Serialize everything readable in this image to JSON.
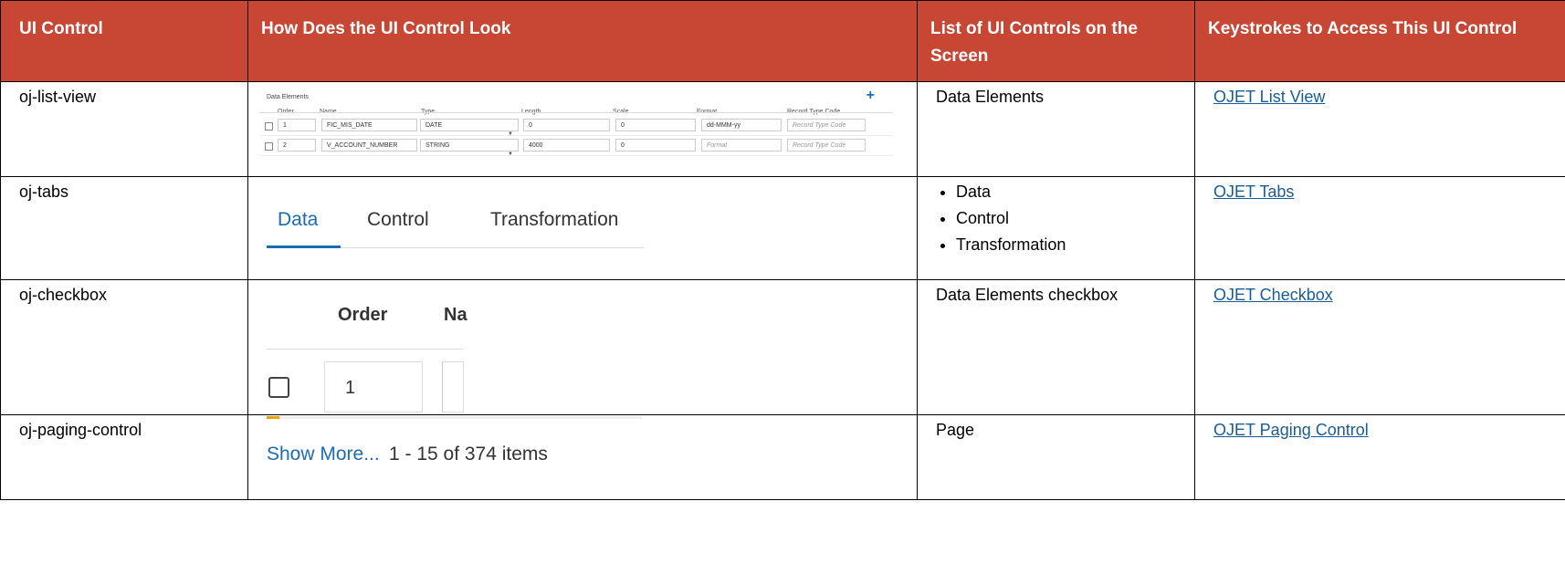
{
  "columns": [
    "UI Control",
    "How Does the UI Control Look",
    "List of UI Controls on the Screen",
    "Keystrokes to Access This UI Control"
  ],
  "rows": [
    {
      "control": "oj-list-view",
      "controls_on_screen": "Data Elements",
      "link": "OJET List View"
    },
    {
      "control": "oj-tabs",
      "controls_on_screen_list": [
        "Data",
        "Control",
        "Transformation"
      ],
      "link": "OJET Tabs"
    },
    {
      "control": "oj-checkbox",
      "controls_on_screen": "Data Elements checkbox",
      "link": "OJET Checkbox"
    },
    {
      "control": "oj-paging-control",
      "controls_on_screen": "Page",
      "link": "OJET Paging Control"
    }
  ],
  "list_view": {
    "title": "Data Elements",
    "add_icon": "plus-icon",
    "headers": [
      "Order",
      "Name",
      "Type",
      "Length",
      "Scale",
      "Format",
      "Record Type Code"
    ],
    "records": [
      {
        "order": "1",
        "name": "FIC_MIS_DATE",
        "type": "DATE",
        "length": "0",
        "scale": "0",
        "format": "dd-MMM-yy",
        "record_type_code": "Record Type Code"
      },
      {
        "order": "2",
        "name": "V_ACCOUNT_NUMBER",
        "type": "STRING",
        "length": "4000",
        "scale": "0",
        "format": "Format",
        "record_type_code": "Record Type Code"
      }
    ]
  },
  "tabs_sample": {
    "tabs": [
      "Data",
      "Control",
      "Transformation"
    ],
    "active": "Data"
  },
  "checkbox_sample": {
    "header_order": "Order",
    "header_name_partial": "Na",
    "order_value": "1"
  },
  "paging_sample": {
    "show_more": "Show More...",
    "count_text": "1 - 15 of 374 items"
  },
  "colors": {
    "header_bg": "#c74634",
    "link": "#1a5d96",
    "accent_blue": "#1a6db5"
  }
}
